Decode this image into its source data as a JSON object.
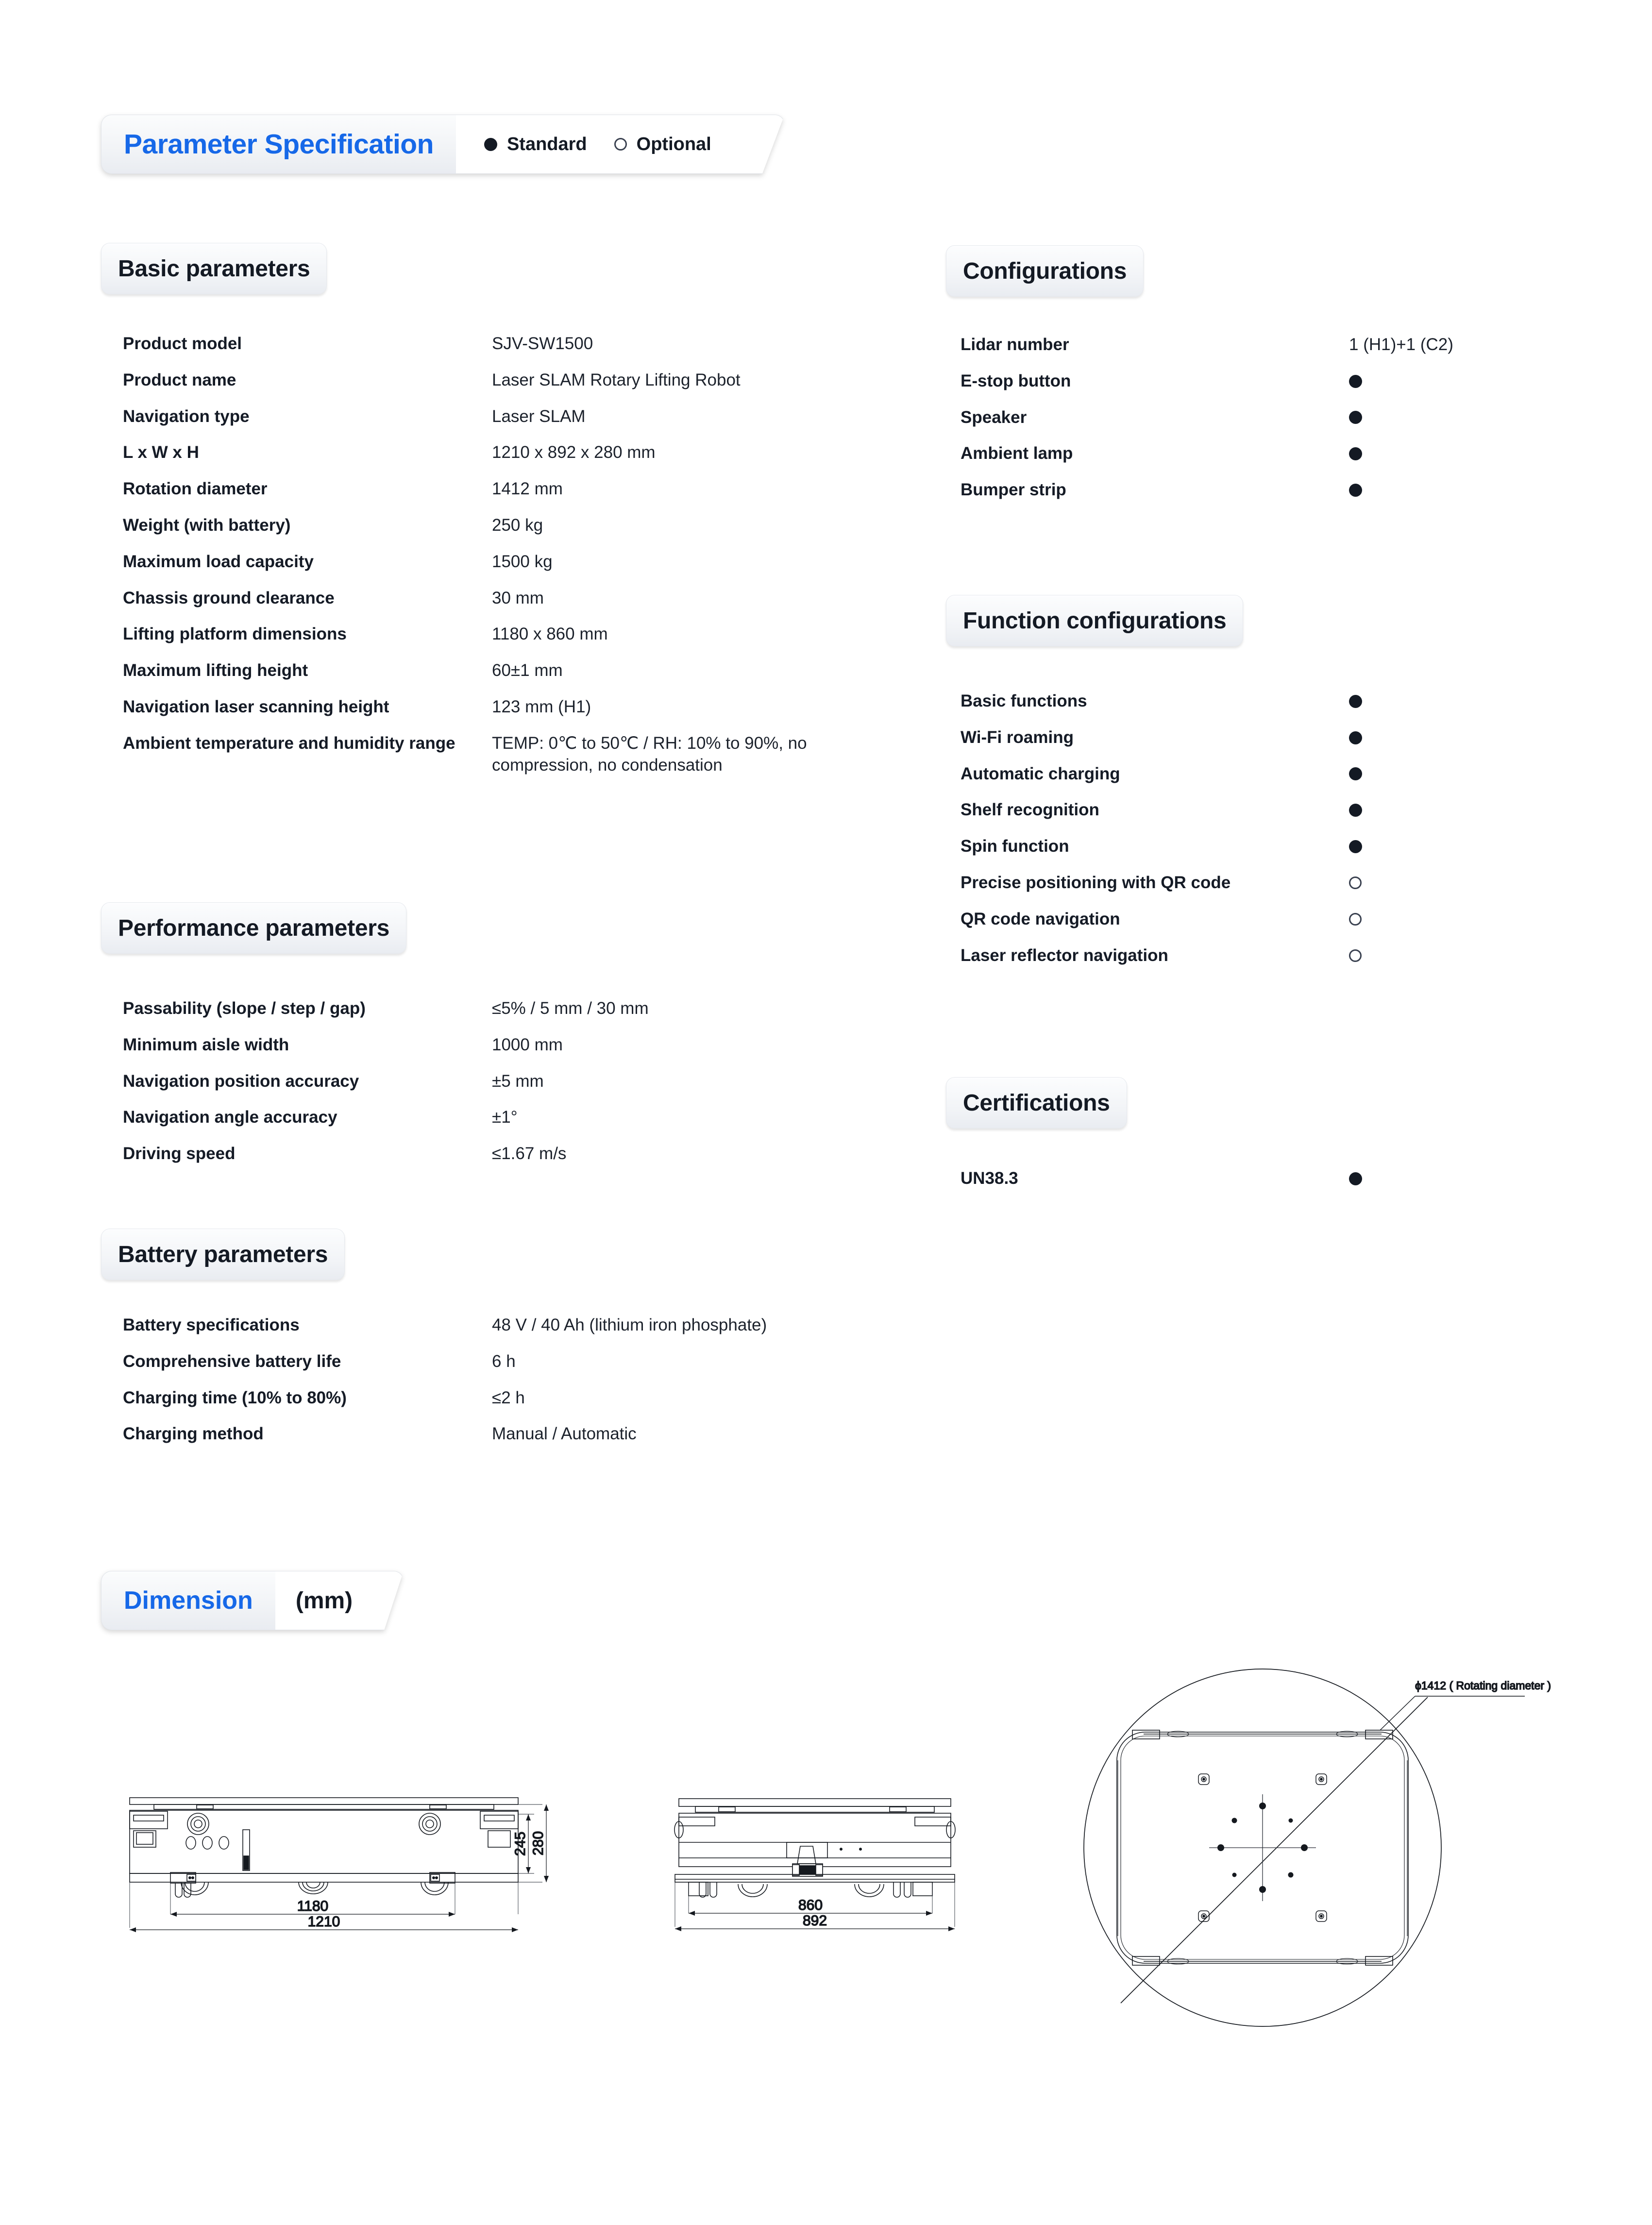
{
  "header": {
    "title": "Parameter Specification",
    "legend": [
      {
        "label": "Standard",
        "mark": "filled"
      },
      {
        "label": "Optional",
        "mark": "hollow"
      }
    ]
  },
  "sections": {
    "basic_parameters": {
      "title": "Basic parameters",
      "rows": [
        {
          "label": "Product model",
          "value": "SJV-SW1500"
        },
        {
          "label": "Product name",
          "value": "Laser SLAM Rotary Lifting Robot"
        },
        {
          "label": "Navigation type",
          "value": "Laser SLAM"
        },
        {
          "label": "L x W x H",
          "value": "1210 x 892 x 280 mm"
        },
        {
          "label": "Rotation diameter",
          "value": "1412 mm"
        },
        {
          "label": "Weight (with battery)",
          "value": "250 kg"
        },
        {
          "label": "Maximum load capacity",
          "value": "1500 kg"
        },
        {
          "label": "Chassis ground clearance",
          "value": "30 mm"
        },
        {
          "label": "Lifting platform dimensions",
          "value": "1180 x 860 mm"
        },
        {
          "label": "Maximum lifting height",
          "value": "60±1 mm"
        },
        {
          "label": "Navigation laser scanning height",
          "value": "123 mm (H1)"
        },
        {
          "label": "Ambient temperature and humidity range",
          "value": "TEMP: 0℃ to 50℃ / RH: 10% to 90%, no compression, no condensation"
        }
      ]
    },
    "performance_parameters": {
      "title": "Performance parameters",
      "rows": [
        {
          "label": "Passability (slope / step / gap)",
          "value": "≤5% / 5 mm / 30 mm"
        },
        {
          "label": "Minimum aisle width",
          "value": "1000 mm"
        },
        {
          "label": "Navigation position accuracy",
          "value": "±5 mm"
        },
        {
          "label": "Navigation angle accuracy",
          "value": "±1°"
        },
        {
          "label": "Driving speed",
          "value": "≤1.67 m/s"
        }
      ]
    },
    "battery_parameters": {
      "title": "Battery parameters",
      "rows": [
        {
          "label": "Battery specifications",
          "value": "48 V / 40 Ah (lithium iron phosphate)"
        },
        {
          "label": "Comprehensive battery life",
          "value": "6 h"
        },
        {
          "label": "Charging time (10% to 80%)",
          "value": "≤2 h"
        },
        {
          "label": "Charging method",
          "value": "Manual / Automatic"
        }
      ]
    },
    "configurations": {
      "title": "Configurations",
      "rows": [
        {
          "label": "Lidar number",
          "value": "1 (H1)+1 (C2)",
          "mark": "text"
        },
        {
          "label": "E-stop button",
          "value": "",
          "mark": "filled"
        },
        {
          "label": "Speaker",
          "value": "",
          "mark": "filled"
        },
        {
          "label": "Ambient lamp",
          "value": "",
          "mark": "filled"
        },
        {
          "label": "Bumper strip",
          "value": "",
          "mark": "filled"
        }
      ]
    },
    "function_configurations": {
      "title": "Function configurations",
      "rows": [
        {
          "label": "Basic functions",
          "mark": "filled"
        },
        {
          "label": "Wi-Fi roaming",
          "mark": "filled"
        },
        {
          "label": "Automatic charging",
          "mark": "filled"
        },
        {
          "label": "Shelf recognition",
          "mark": "filled"
        },
        {
          "label": "Spin function",
          "mark": "filled"
        },
        {
          "label": "Precise positioning with QR code",
          "mark": "hollow"
        },
        {
          "label": "QR code navigation",
          "mark": "hollow"
        },
        {
          "label": "Laser reflector navigation",
          "mark": "hollow"
        }
      ]
    },
    "certifications": {
      "title": "Certifications",
      "rows": [
        {
          "label": "UN38.3",
          "mark": "filled"
        }
      ]
    }
  },
  "dimension": {
    "title": "Dimension",
    "unit": "(mm)",
    "side_view": {
      "width_inner": "1180",
      "width_outer": "1210",
      "height_inner": "245",
      "height_outer": "280"
    },
    "front_view": {
      "width_inner": "860",
      "width_outer": "892"
    },
    "top_view": {
      "rotating_diameter": "ϕ1412 ( Rotating diameter )"
    }
  },
  "colors": {
    "accent_blue": "#1668e8",
    "text_dark": "#141a24",
    "mark_dark": "#141a24",
    "line": "#15191f"
  }
}
